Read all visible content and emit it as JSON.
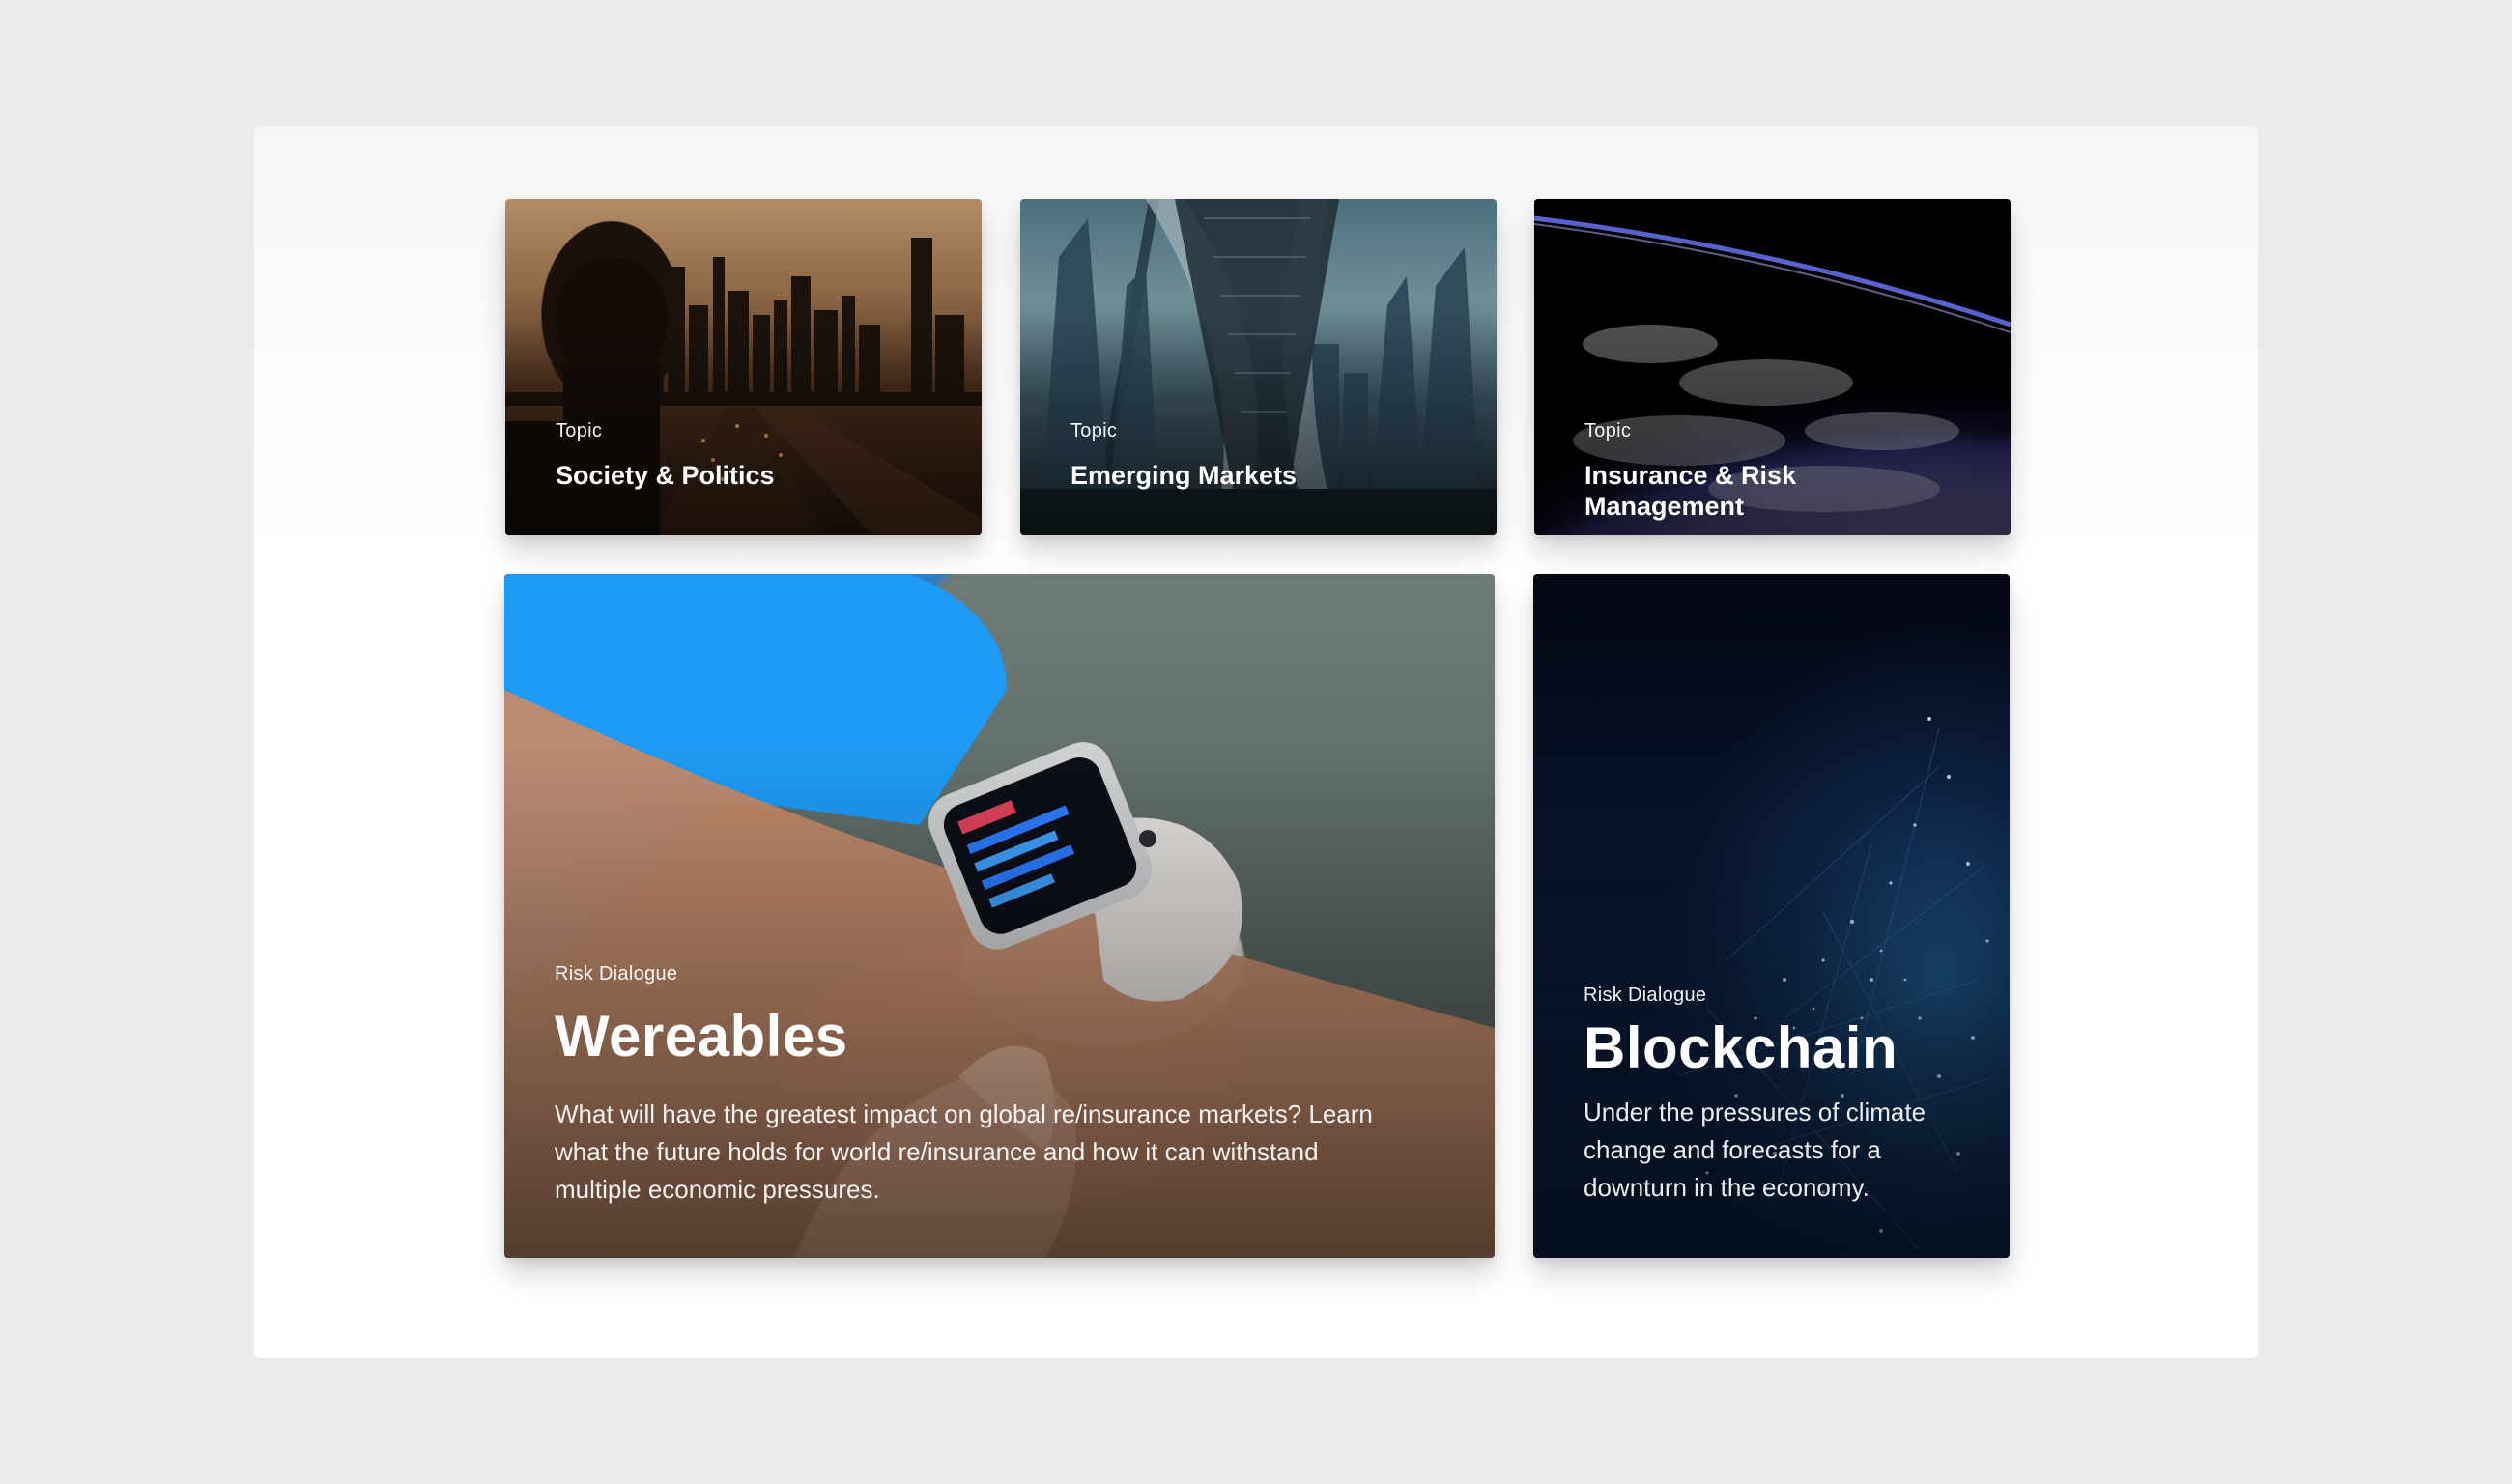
{
  "cards": [
    {
      "eyebrow": "Topic",
      "title": "Society & Politics"
    },
    {
      "eyebrow": "Topic",
      "title": "Emerging Markets"
    },
    {
      "eyebrow": "Topic",
      "title": "Insurance & Risk Management"
    },
    {
      "eyebrow": "Risk Dialogue",
      "title": "Wereables",
      "description": "What will have the greatest impact on global re/insurance markets? Learn what the future holds for world re/insurance and how it can withstand multiple economic pressures."
    },
    {
      "eyebrow": "Risk Dialogue",
      "title": "Blockchain",
      "description": "Under the pressures of climate change and forecasts for a downturn in the economy."
    }
  ]
}
